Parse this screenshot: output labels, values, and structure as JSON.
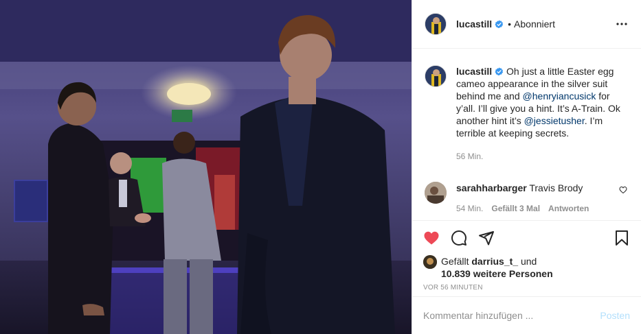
{
  "header": {
    "username": "lucastill",
    "verified": true,
    "separator": "•",
    "follow_state": "Abonniert",
    "more_icon": "ellipsis-icon"
  },
  "caption": {
    "username": "lucastill",
    "text_1": "Oh just a little Easter egg cameo appearance in the silver suit behind me and ",
    "mention_1": "@henryiancusick",
    "text_2": " for y’all. I’ll give you a hint. It’s A-Train. Ok another hint it’s ",
    "mention_2": "@jessietusher",
    "text_3": ". I’m terrible at keeping secrets.",
    "time": "56 Min."
  },
  "comment": {
    "username": "sarahharbarger",
    "text": "Travis Brody",
    "time": "54 Min.",
    "likes": "Gefällt 3 Mal",
    "reply": "Antworten"
  },
  "actions": {
    "like_icon": "heart-filled-icon",
    "comment_icon": "comment-icon",
    "share_icon": "paper-plane-icon",
    "save_icon": "bookmark-icon",
    "like_color": "#ed4956"
  },
  "likes": {
    "prefix": "Gefällt ",
    "user": "darrius_t_",
    "middle": " und",
    "count": "10.839 weitere Personen"
  },
  "timestamp": "VOR 56 MINUTEN",
  "add_comment": {
    "placeholder": "Kommentar hinzufügen ...",
    "post_label": "Posten"
  },
  "colors": {
    "verified_blue": "#3897f0",
    "link_blue": "#00376b",
    "muted": "#8e8e8e",
    "post_button": "#b2dffc"
  }
}
